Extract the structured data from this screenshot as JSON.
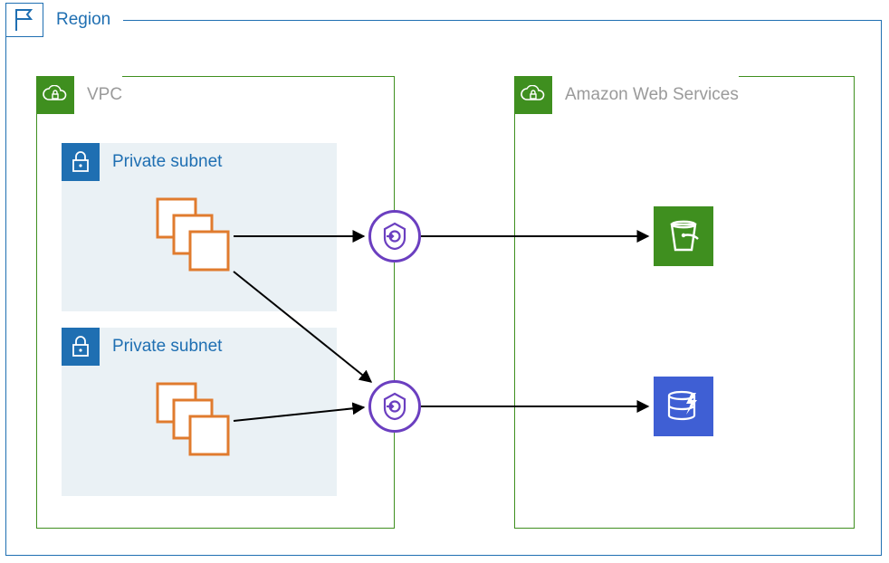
{
  "region": {
    "label": "Region",
    "icon": "flag-icon",
    "border_color": "#1f6fb2"
  },
  "vpc": {
    "label": "VPC",
    "icon": "cloud-lock-icon",
    "border_color": "#3f8f1f",
    "subnets": [
      {
        "label": "Private subnet",
        "icon": "padlock-icon",
        "instances_icon": "instances-icon"
      },
      {
        "label": "Private subnet",
        "icon": "padlock-icon",
        "instances_icon": "instances-icon"
      }
    ],
    "endpoints": [
      {
        "icon": "vpc-endpoint-icon",
        "color": "#6b3fc0"
      },
      {
        "icon": "vpc-endpoint-icon",
        "color": "#6b3fc0"
      }
    ]
  },
  "aws": {
    "label": "Amazon Web Services",
    "icon": "cloud-lock-icon",
    "border_color": "#3f8f1f",
    "services": [
      {
        "name": "s3",
        "icon": "s3-bucket-icon",
        "color": "#3f8f1f"
      },
      {
        "name": "dynamodb",
        "icon": "dynamodb-icon",
        "color": "#3f5fd4"
      }
    ]
  },
  "arrows": [
    {
      "from": "subnet1-instances",
      "to": "endpoint1"
    },
    {
      "from": "subnet1-instances",
      "to": "endpoint2"
    },
    {
      "from": "subnet2-instances",
      "to": "endpoint2"
    },
    {
      "from": "endpoint1",
      "to": "s3-service"
    },
    {
      "from": "endpoint2",
      "to": "dynamodb-service"
    }
  ],
  "colors": {
    "region_blue": "#1f6fb2",
    "vpc_green": "#3f8f1f",
    "subnet_bg": "#eaf1f5",
    "instance_orange": "#e07b2e",
    "endpoint_purple": "#6b3fc0",
    "dynamodb_blue": "#3f5fd4",
    "label_grey": "#9a9a9a"
  }
}
